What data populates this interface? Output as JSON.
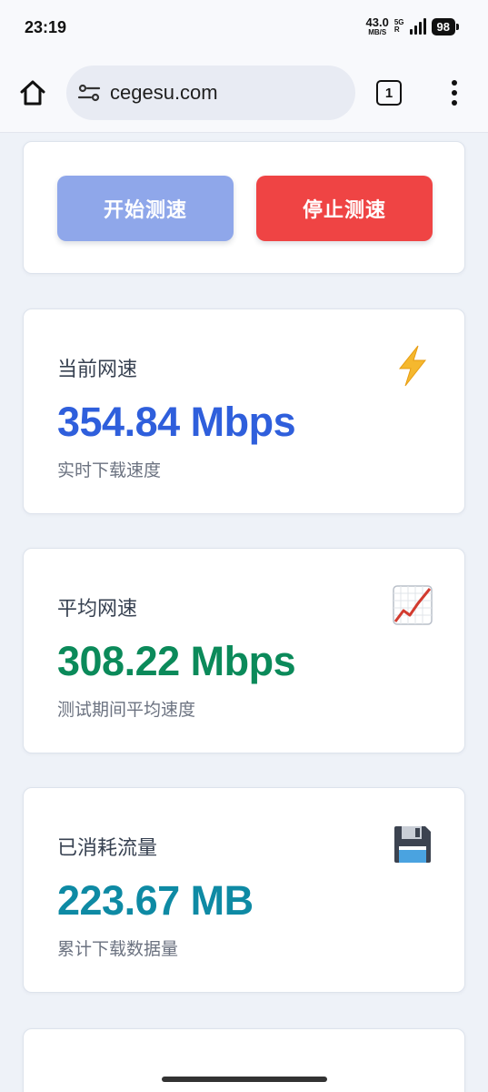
{
  "status_bar": {
    "time": "23:19",
    "net_speed_value": "43.0",
    "net_speed_unit": "MB/S",
    "signal_top": "5G",
    "signal_bottom": "R",
    "battery": "98"
  },
  "browser": {
    "url": "cegesu.com",
    "tab_count": "1",
    "icons": [
      "home-icon",
      "site-settings-icon",
      "tabs-icon",
      "more-vert-icon"
    ]
  },
  "controls": {
    "start_label": "开始测速",
    "stop_label": "停止测速",
    "start_color": "#8fa7ea",
    "stop_color": "#ef4444"
  },
  "stats": [
    {
      "title": "当前网速",
      "value": "354.84 Mbps",
      "subtitle": "实时下载速度",
      "icon": "lightning-icon",
      "color": "#2f5fdc"
    },
    {
      "title": "平均网速",
      "value": "308.22 Mbps",
      "subtitle": "测试期间平均速度",
      "icon": "chart-increasing-icon",
      "color": "#0b8a5a"
    },
    {
      "title": "已消耗流量",
      "value": "223.67 MB",
      "subtitle": "累计下载数据量",
      "icon": "floppy-disk-icon",
      "color": "#0e8aa4"
    }
  ]
}
